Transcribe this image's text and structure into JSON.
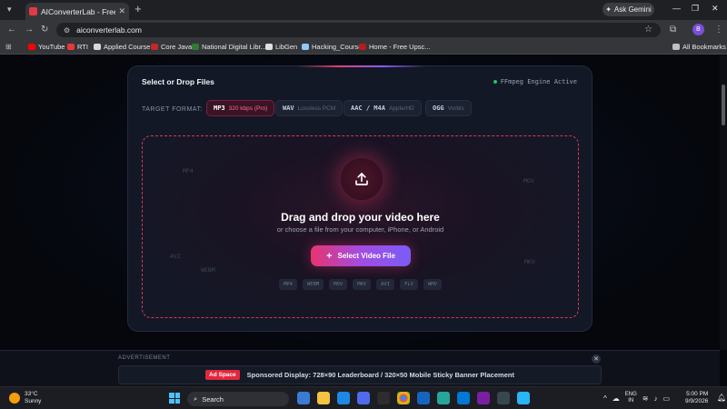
{
  "browser": {
    "tab_title": "AIConverterLab - Free & Private",
    "new_tab": "+",
    "ask_gemini": "Ask Gemini",
    "url": "aiconverterlab.com",
    "profile_initial": "B",
    "bookmarks": [
      "YouTube",
      "RTI",
      "Applied Course",
      "Core Java",
      "National Digital Libr...",
      "LibGen",
      "Hacking_Course",
      "Home - Free Upsc..."
    ],
    "all_bookmarks": "All Bookmarks"
  },
  "card": {
    "title": "Select or Drop Files",
    "engine_status": "FFmpeg Engine Active",
    "target_format_label": "TARGET FORMAT:",
    "formats": [
      {
        "name": "MP3",
        "desc": "320 kbps (Pro)",
        "active": true
      },
      {
        "name": "WAV",
        "desc": "Lossless PCM",
        "active": false
      },
      {
        "name": "AAC / M4A",
        "desc": "Apple/HD",
        "active": false
      },
      {
        "name": "OGG",
        "desc": "Vorbis",
        "active": false
      }
    ]
  },
  "dropzone": {
    "title": "Drag and drop your video here",
    "subtitle": "or choose a file from your computer, iPhone, or Android",
    "button": "Select Video File",
    "button_plus": "+",
    "extensions": [
      "MP4",
      "WEBM",
      "MOV",
      "MKV",
      "AVI",
      "FLV",
      "WMV"
    ],
    "ghost_labels": [
      "MP4",
      "MOV",
      "AVI",
      "MKV",
      "WEBM"
    ]
  },
  "ad": {
    "label": "ADVERTISEMENT",
    "close": "✕",
    "badge": "Ad Space",
    "text": "Sponsored Display: 728×90 Leaderboard / 320×50 Mobile Sticky Banner Placement"
  },
  "taskbar": {
    "temp": "33°C",
    "condition": "Sunny",
    "search": "Search",
    "lang_1": "ENG",
    "lang_2": "IN",
    "time": "5:00 PM",
    "date": "9/9/2026"
  },
  "colors": {
    "accent": "#e0335a",
    "button_start": "#e8336f",
    "button_end": "#7a5cf6",
    "engine_dot": "#22c55e"
  }
}
